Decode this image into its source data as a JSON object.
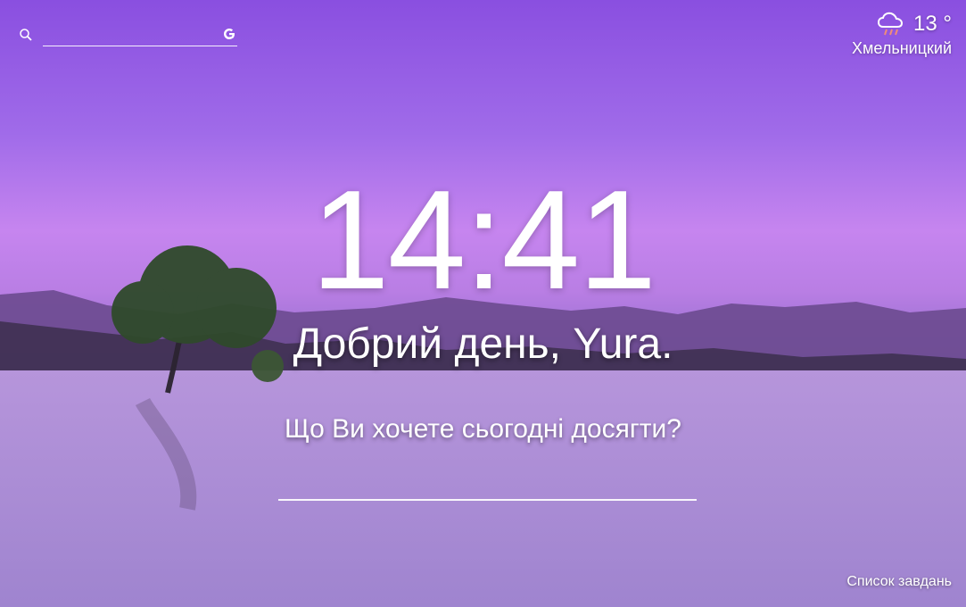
{
  "search": {
    "placeholder": "",
    "icon": "search-icon",
    "engine_icon": "google-g-icon"
  },
  "weather": {
    "temperature": "13 °",
    "city": "Хмельницкий",
    "icon": "rain-cloud-icon"
  },
  "clock": {
    "time": "14:41"
  },
  "greeting": {
    "text": "Добрий день, Yura."
  },
  "focus": {
    "question": "Що Ви хочете сьогодні досягти?",
    "value": ""
  },
  "todo": {
    "label": "Список завдань"
  }
}
